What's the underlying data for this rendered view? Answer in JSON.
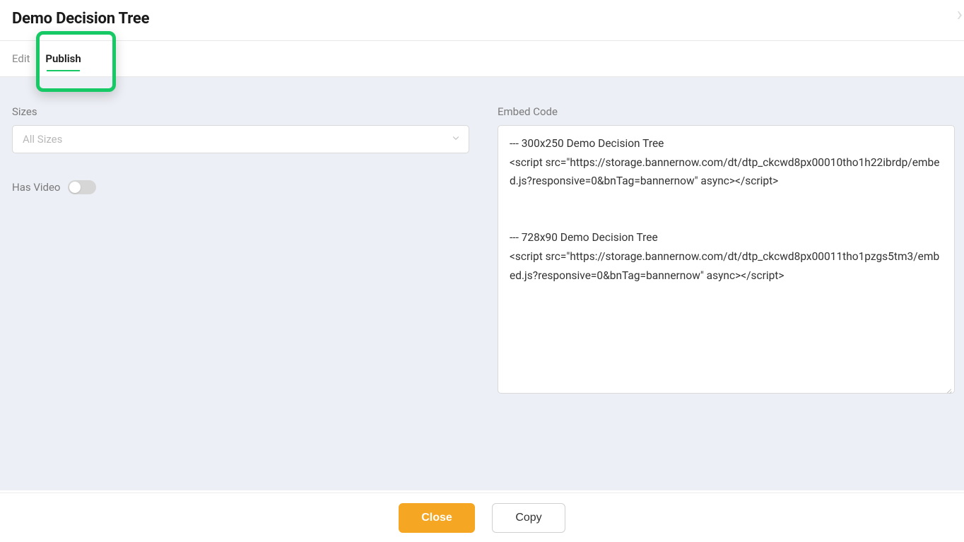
{
  "header": {
    "title": "Demo Decision Tree"
  },
  "tabs": {
    "edit_label": "Edit",
    "publish_label": "Publish"
  },
  "left": {
    "sizes_label": "Sizes",
    "sizes_placeholder": "All Sizes",
    "has_video_label": "Has Video"
  },
  "right": {
    "embed_label": "Embed Code",
    "embed_value": "--- 300x250 Demo Decision Tree\n<script src=\"https://storage.bannernow.com/dt/dtp_ckcwd8px00010tho1h22ibrdp/embed.js?responsive=0&bnTag=bannernow\" async></script>\n\n\n--- 728x90 Demo Decision Tree\n<script src=\"https://storage.bannernow.com/dt/dtp_ckcwd8px00011tho1pzgs5tm3/embed.js?responsive=0&bnTag=bannernow\" async></script>"
  },
  "footer": {
    "close_label": "Close",
    "copy_label": "Copy"
  }
}
